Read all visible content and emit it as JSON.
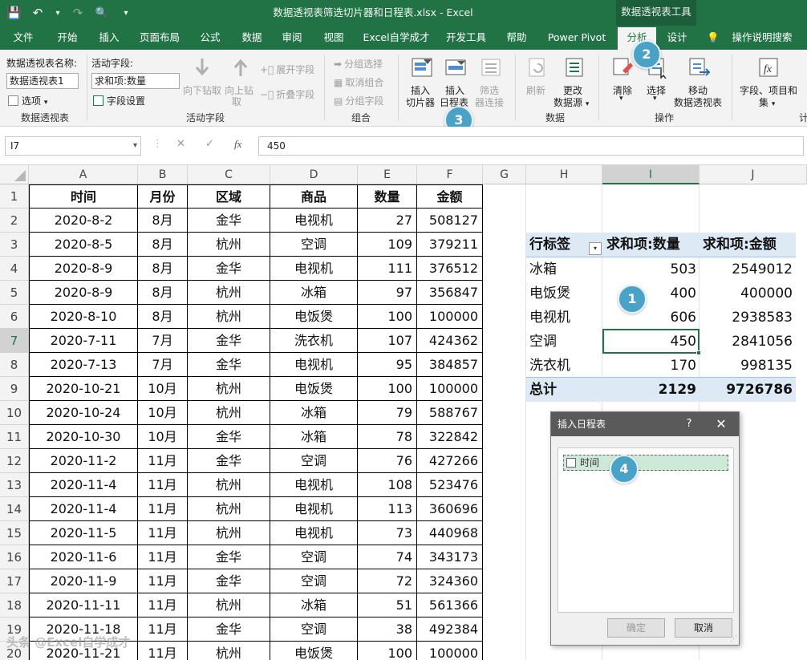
{
  "titlebar": {
    "title": "数据透视表筛选切片器和日程表.xlsx  -  Excel",
    "context_tab": "数据透视表工具",
    "qat": {
      "save": "💾",
      "undo": "↶",
      "undo_dd": "▾",
      "redo": "↷",
      "preview": "🔍",
      "more": "▾"
    }
  },
  "tabs": [
    "文件",
    "开始",
    "插入",
    "页面布局",
    "公式",
    "数据",
    "审阅",
    "视图",
    "Excel自学成才",
    "开发工具",
    "帮助",
    "Power Pivot",
    "分析",
    "设计",
    "💡",
    "操作说明搜索"
  ],
  "ribbon": {
    "pt_name_label": "数据透视表名称:",
    "pt_name_value": "数据透视表1",
    "options_label": "选项",
    "active_field_label": "活动字段:",
    "active_field_value": "求和项:数量",
    "field_settings_label": "字段设置",
    "drill_down_label": "向下钻取",
    "drill_up_label": "向上钻",
    "drill_up_label2": "取",
    "expand_field_label": "展开字段",
    "collapse_field_label": "折叠字段",
    "group_selection_label": "分组选择",
    "ungroup_label": "取消组合",
    "group_field_label": "分组字段",
    "insert_slicer_label": "插入",
    "insert_slicer_label2": "切片器",
    "insert_timeline_label": "插入",
    "insert_timeline_label2": "日程表",
    "filter_conn_label": "筛选",
    "filter_conn_label2": "器连接",
    "refresh_label": "刷新",
    "change_source_label": "更改",
    "change_source_label2": "数据源",
    "clear_label": "清除",
    "select_label": "选择",
    "move_pt_label": "移动",
    "move_pt_label2": "数据透视表",
    "fields_items_label": "字段、项目和",
    "fields_items_label2": "集",
    "group_labels": {
      "pivottable": "数据透视表",
      "active_field": "活动字段",
      "group": "组合",
      "data": "数据",
      "actions": "操作",
      "calc": "计"
    }
  },
  "formula_bar": {
    "name_box": "I7",
    "cancel": "✕",
    "enter": "✓",
    "fx": "fx",
    "value": "450"
  },
  "columns": [
    "A",
    "B",
    "C",
    "D",
    "E",
    "F",
    "G",
    "H",
    "I",
    "J"
  ],
  "rows": [
    "1",
    "2",
    "3",
    "4",
    "5",
    "6",
    "7",
    "8",
    "9",
    "10",
    "11",
    "12",
    "13",
    "14",
    "15",
    "16",
    "17",
    "18",
    "19",
    "20"
  ],
  "table": {
    "headers": [
      "时间",
      "月份",
      "区域",
      "商品",
      "数量",
      "金额"
    ],
    "data": [
      [
        "2020-8-2",
        "8月",
        "金华",
        "电视机",
        "27",
        "508127"
      ],
      [
        "2020-8-5",
        "8月",
        "杭州",
        "空调",
        "109",
        "379211"
      ],
      [
        "2020-8-9",
        "8月",
        "金华",
        "电视机",
        "111",
        "376512"
      ],
      [
        "2020-8-9",
        "8月",
        "杭州",
        "冰箱",
        "97",
        "356847"
      ],
      [
        "2020-8-10",
        "8月",
        "杭州",
        "电饭煲",
        "100",
        "100000"
      ],
      [
        "2020-7-11",
        "7月",
        "金华",
        "洗衣机",
        "107",
        "424362"
      ],
      [
        "2020-7-13",
        "7月",
        "金华",
        "电视机",
        "95",
        "384857"
      ],
      [
        "2020-10-21",
        "10月",
        "杭州",
        "电饭煲",
        "100",
        "100000"
      ],
      [
        "2020-10-24",
        "10月",
        "杭州",
        "冰箱",
        "79",
        "588767"
      ],
      [
        "2020-10-30",
        "10月",
        "金华",
        "冰箱",
        "78",
        "322842"
      ],
      [
        "2020-11-2",
        "11月",
        "金华",
        "空调",
        "76",
        "427266"
      ],
      [
        "2020-11-4",
        "11月",
        "杭州",
        "电视机",
        "108",
        "523476"
      ],
      [
        "2020-11-4",
        "11月",
        "杭州",
        "电视机",
        "113",
        "360696"
      ],
      [
        "2020-11-5",
        "11月",
        "杭州",
        "电视机",
        "73",
        "440968"
      ],
      [
        "2020-11-6",
        "11月",
        "金华",
        "空调",
        "74",
        "343173"
      ],
      [
        "2020-11-9",
        "11月",
        "金华",
        "空调",
        "72",
        "324360"
      ],
      [
        "2020-11-11",
        "11月",
        "杭州",
        "冰箱",
        "51",
        "561366"
      ],
      [
        "2020-11-18",
        "11月",
        "金华",
        "空调",
        "38",
        "492384"
      ],
      [
        "2020-11-21",
        "11月",
        "杭州",
        "电饭煲",
        "100",
        "100000"
      ]
    ]
  },
  "pivot": {
    "headers": [
      "行标签",
      "求和项:数量",
      "求和项:金额"
    ],
    "filter_glyph": "▾",
    "rows": [
      [
        "冰箱",
        "503",
        "2549012"
      ],
      [
        "电饭煲",
        "400",
        "400000"
      ],
      [
        "电视机",
        "606",
        "2938583"
      ],
      [
        "空调",
        "450",
        "2841056"
      ],
      [
        "洗衣机",
        "170",
        "998135"
      ]
    ],
    "total": [
      "总计",
      "2129",
      "9726786"
    ]
  },
  "dialog": {
    "title": "插入日程表",
    "help": "?",
    "close": "✕",
    "item": "时间",
    "ok": "确定",
    "cancel": "取消"
  },
  "callouts": [
    "1",
    "2",
    "3",
    "4"
  ],
  "watermark": "头条 @Excel自学成才",
  "colors": {
    "excel_green": "#217346",
    "callout": "#4aa3c6",
    "pivot_band": "#dde9f5"
  }
}
